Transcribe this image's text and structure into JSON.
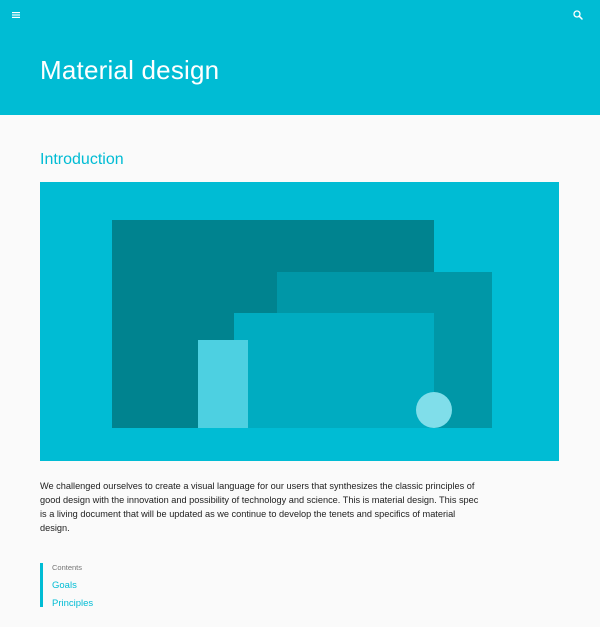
{
  "header": {
    "title": "Material design",
    "background_color": "#00bcd4",
    "menu_icon": "hamburger-menu-icon",
    "search_icon": "search-icon"
  },
  "section": {
    "title": "Introduction",
    "accent_color": "#00bcd4"
  },
  "hero_illustration": {
    "description_colors": [
      "#00bcd4",
      "#00838f",
      "#0097a7",
      "#00acc1",
      "#4dd0e1",
      "#80deea"
    ]
  },
  "intro": {
    "text": "We challenged ourselves to create a visual language for our users that synthesizes the classic principles of good design with the innovation and possibility of technology and science. This is material design. This spec is a living document that will be updated as we continue to develop the tenets and specifics of material design."
  },
  "contents": {
    "heading": "Contents",
    "links": [
      "Goals",
      "Principles"
    ]
  }
}
